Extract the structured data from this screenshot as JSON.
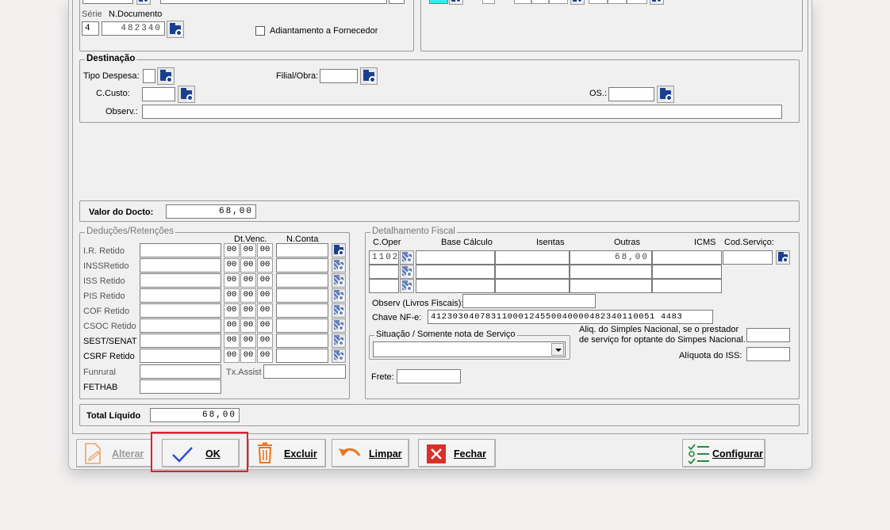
{
  "fornecedor": {
    "serie_label": "Série",
    "ndoc_label": "N.Documento",
    "serie_value": "4",
    "ndoc_value": "482340",
    "adiantamento_label": "Adiantamento a Fornecedor"
  },
  "destinacao": {
    "title": "Destinação",
    "tipo_despesa_label": "Tipo Despesa:",
    "filial_obra_label": "Filial/Obra:",
    "ccusto_label": "C.Custo:",
    "os_label": "OS.:",
    "observ_label": "Observ.:"
  },
  "valor": {
    "label": "Valor do Docto:",
    "value": "68,00"
  },
  "deducoes": {
    "title": "Deduções/Retenções",
    "dt_venc_label": "Dt.Venc.",
    "n_conta_label": "N.Conta",
    "date_placeholder": "00",
    "rows": [
      {
        "label": "I.R. Retido"
      },
      {
        "label": "INSSRetido"
      },
      {
        "label": "ISS Retido"
      },
      {
        "label": "PIS Retido"
      },
      {
        "label": "COF Retido"
      },
      {
        "label": "CSOC Retido"
      },
      {
        "label": "SEST/SENAT"
      },
      {
        "label": "CSRF Retido"
      }
    ],
    "funrural_label": "Funrural",
    "fethab_label": "FETHAB",
    "tx_assist_label": "Tx.Assist"
  },
  "fiscal": {
    "title": "Detalhamento Fiscal",
    "columns": [
      "C.Oper",
      "Base Cálculo",
      "Isentas",
      "Outras",
      "ICMS",
      "Cod.Serviço:"
    ],
    "rows": [
      {
        "coper": "1102",
        "outras": "68,00"
      },
      {
        "coper": "",
        "outras": ""
      },
      {
        "coper": "",
        "outras": ""
      }
    ],
    "observ_label": "Observ (Livros Fiscais):",
    "chave_label": "Chave NF-e:",
    "chave_value": "41230304078311000124550040000482340110051 4483",
    "situacao_label": "Situação / Somente nota de Serviço",
    "aliq_simples_line1": "Aliq. do Simples Nacional, se o prestador",
    "aliq_simples_line2": "de serviço for optante do Simpes Nacional.",
    "aliq_iss_label": "Alíquota do ISS:",
    "frete_label": "Frete:"
  },
  "total": {
    "label": "Total Líquido",
    "value": "68,00"
  },
  "buttons": {
    "alterar": "Alterar",
    "ok": "OK",
    "excluir": "Excluir",
    "limpar": "Limpar",
    "fechar": "Fechar",
    "configurar": "Configurar"
  },
  "colors": {
    "highlight": "#e0202e",
    "ok_check": "#2b4fd1",
    "excluir": "#e87722",
    "fechar": "#d9302a",
    "configurar": "#2a8a3a"
  }
}
